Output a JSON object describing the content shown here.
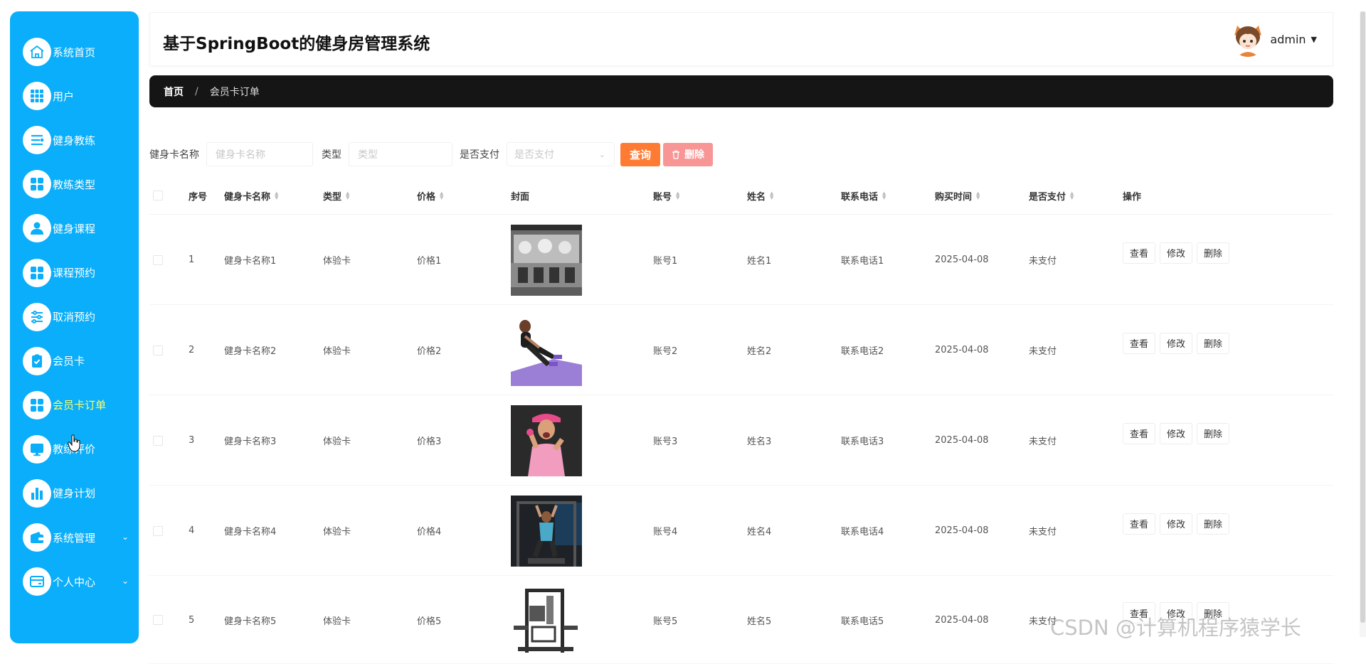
{
  "sidebar": {
    "items": [
      {
        "label": "系统首页",
        "icon": "home-icon"
      },
      {
        "label": "用户",
        "icon": "grid-icon"
      },
      {
        "label": "健身教练",
        "icon": "list-icon"
      },
      {
        "label": "教练类型",
        "icon": "apps-icon"
      },
      {
        "label": "健身课程",
        "icon": "user-icon"
      },
      {
        "label": "课程预约",
        "icon": "apps-icon"
      },
      {
        "label": "取消预约",
        "icon": "sliders-icon"
      },
      {
        "label": "会员卡",
        "icon": "clipboard-check-icon"
      },
      {
        "label": "会员卡订单",
        "icon": "apps-icon",
        "active": true
      },
      {
        "label": "教练评价",
        "icon": "monitor-icon"
      },
      {
        "label": "健身计划",
        "icon": "bar-chart-icon"
      },
      {
        "label": "系统管理",
        "icon": "wallet-icon",
        "expandable": true
      },
      {
        "label": "个人中心",
        "icon": "card-icon",
        "expandable": true
      }
    ]
  },
  "header": {
    "title": "基于SpringBoot的健身房管理系统",
    "username": "admin"
  },
  "breadcrumb": {
    "home": "首页",
    "separator": "/",
    "current": "会员卡订单"
  },
  "filters": {
    "card_name_label": "健身卡名称",
    "card_name_placeholder": "健身卡名称",
    "type_label": "类型",
    "type_placeholder": "类型",
    "paid_label": "是否支付",
    "paid_placeholder": "是否支付",
    "query_button": "查询",
    "delete_button": "删除"
  },
  "table": {
    "columns": [
      "序号",
      "健身卡名称",
      "类型",
      "价格",
      "封面",
      "账号",
      "姓名",
      "联系电话",
      "购买时间",
      "是否支付",
      "操作"
    ],
    "rows": [
      {
        "no": "1",
        "card_name": "健身卡名称1",
        "type": "体验卡",
        "price": "价格1",
        "account": "账号1",
        "name": "姓名1",
        "phone": "联系电话1",
        "date": "2025-04-08",
        "paid": "未支付"
      },
      {
        "no": "2",
        "card_name": "健身卡名称2",
        "type": "体验卡",
        "price": "价格2",
        "account": "账号2",
        "name": "姓名2",
        "phone": "联系电话2",
        "date": "2025-04-08",
        "paid": "未支付"
      },
      {
        "no": "3",
        "card_name": "健身卡名称3",
        "type": "体验卡",
        "price": "价格3",
        "account": "账号3",
        "name": "姓名3",
        "phone": "联系电话3",
        "date": "2025-04-08",
        "paid": "未支付"
      },
      {
        "no": "4",
        "card_name": "健身卡名称4",
        "type": "体验卡",
        "price": "价格4",
        "account": "账号4",
        "name": "姓名4",
        "phone": "联系电话4",
        "date": "2025-04-08",
        "paid": "未支付"
      },
      {
        "no": "5",
        "card_name": "健身卡名称5",
        "type": "体验卡",
        "price": "价格5",
        "account": "账号5",
        "name": "姓名5",
        "phone": "联系电话5",
        "date": "2025-04-08",
        "paid": "未支付"
      }
    ],
    "actions": {
      "view": "查看",
      "edit": "修改",
      "delete": "删除"
    }
  },
  "watermark": "CSDN @计算机程序猿学长",
  "colors": {
    "sidebar_bg": "#0aaefa",
    "active_menu_text": "#ffff66",
    "breadcrumb_bg": "#151515",
    "query_button": "#ff7b34",
    "delete_button": "#f89696"
  }
}
